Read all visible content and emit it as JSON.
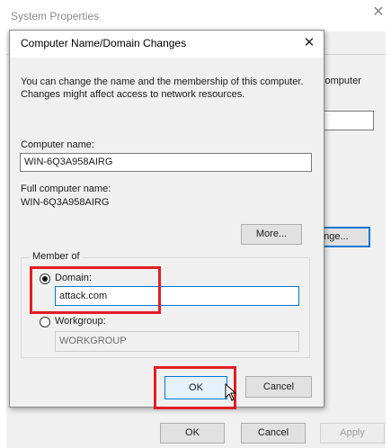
{
  "system_properties": {
    "title": "System Properties",
    "side_text": "computer",
    "change_button_partial": "ange...",
    "ok_label": "OK",
    "cancel_label": "Cancel",
    "apply_label": "Apply"
  },
  "dialog": {
    "title": "Computer Name/Domain Changes",
    "description": "You can change the name and the membership of this computer. Changes might affect access to network resources.",
    "computer_name_label": "Computer name:",
    "computer_name_value": "WIN-6Q3A958AIRG",
    "full_name_label": "Full computer name:",
    "full_name_value": "WIN-6Q3A958AIRG",
    "more_label": "More...",
    "member_of_label": "Member of",
    "domain_label": "Domain:",
    "domain_value": "attack.com",
    "domain_selected": true,
    "workgroup_label": "Workgroup:",
    "workgroup_value": "WORKGROUP",
    "ok_label": "OK",
    "cancel_label": "Cancel"
  },
  "colors": {
    "highlight": "#e21d25",
    "focus_blue": "#0078d7"
  }
}
